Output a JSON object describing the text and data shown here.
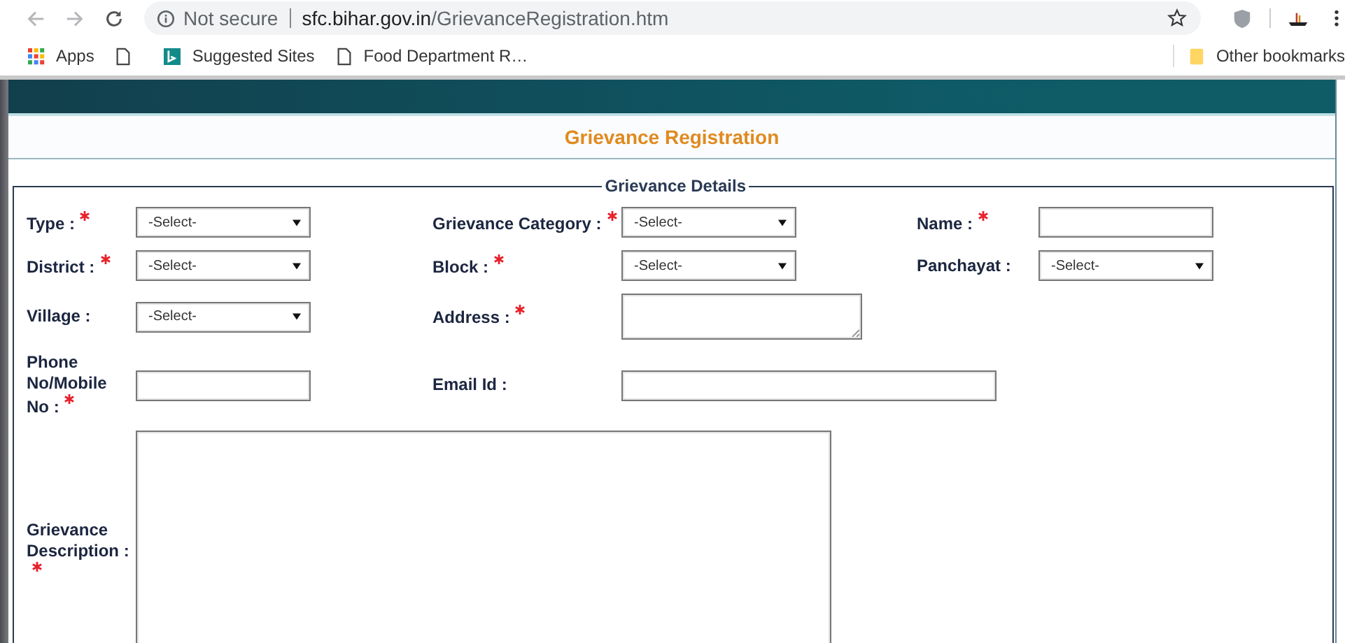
{
  "browser": {
    "security": "Not secure",
    "host": "sfc.bihar.gov.in",
    "path": "/GrievanceRegistration.htm",
    "bookmarks": [
      {
        "kind": "apps",
        "label": "Apps"
      },
      {
        "kind": "page"
      },
      {
        "kind": "bing",
        "label": "Suggested Sites"
      },
      {
        "kind": "page",
        "label": "Food Department R…"
      }
    ],
    "other_bookmarks": "Other bookmarks"
  },
  "page": {
    "title": "Grievance Registration",
    "legend": "Grievance Details",
    "rows": [
      {
        "fields": [
          {
            "label": "Type :",
            "required": true,
            "kind": "select",
            "value": "-Select-"
          },
          {
            "label": "Grievance Category :",
            "required": true,
            "kind": "select",
            "value": "-Select-"
          },
          {
            "label": "Name :",
            "required": true,
            "kind": "text"
          }
        ]
      },
      {
        "fields": [
          {
            "label": "District :",
            "required": true,
            "kind": "select",
            "value": "-Select-"
          },
          {
            "label": "Block :",
            "required": true,
            "kind": "select",
            "value": "-Select-"
          },
          {
            "label": "Panchayat :",
            "required": false,
            "kind": "select",
            "value": "-Select-"
          }
        ]
      },
      {
        "fields": [
          {
            "label": "Village :",
            "required": false,
            "kind": "select",
            "value": "-Select-"
          },
          {
            "label": "Address :",
            "required": true,
            "kind": "textarea"
          }
        ]
      },
      {
        "fields": [
          {
            "label": "Phone No/Mobile No :",
            "required": true,
            "kind": "text"
          },
          {
            "label": "Email Id :",
            "required": false,
            "kind": "text-wide"
          }
        ]
      },
      {
        "fields": [
          {
            "label": "Grievance Description :",
            "required": true,
            "kind": "textarea-large"
          }
        ]
      }
    ]
  }
}
